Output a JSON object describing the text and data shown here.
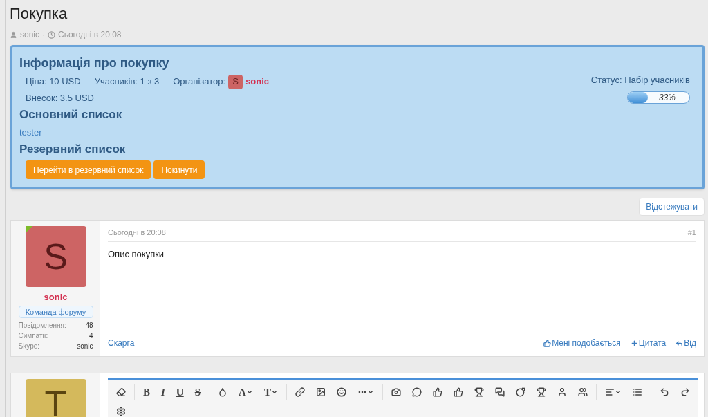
{
  "page": {
    "title": "Покупка",
    "author": "sonic",
    "separator": "·",
    "time": "Сьогодні в 20:08"
  },
  "purchase": {
    "heading": "Інформація про покупку",
    "price": "Ціна: 10 USD",
    "participants": "Учасників: 1 з 3",
    "organizer_label": "Організатор:",
    "organizer_avatar": "S",
    "organizer": "sonic",
    "fee": "Внесок: 3.5 USD",
    "status": "Статус: Набір учасників",
    "progress": {
      "level": 0.33,
      "reading": "33%"
    },
    "main_list_heading": "Основний список",
    "main_list": [
      "tester"
    ],
    "reserve_list_heading": "Резервний список",
    "buttons": [
      "Перейти в резервний список",
      "Покинути"
    ]
  },
  "follow_button": "Відстежувати",
  "posts": [
    {
      "avatar": "S",
      "color": "#cd6464",
      "online": true,
      "username": "sonic",
      "user_title": "Команда форуму",
      "stats": [
        {
          "label": "Повідомлення:",
          "value": "48"
        },
        {
          "label": "Симпатії:",
          "value": "4"
        },
        {
          "label": "Skype:",
          "value": "sonic"
        }
      ],
      "time": "Сьогодні в 20:08",
      "number": "#1",
      "body": "Опис покупки",
      "report": "Скарга",
      "actions": [
        "Мені подобається",
        "Цитата",
        "Від"
      ]
    }
  ],
  "reply": {
    "avatar": "T",
    "color": "#d4b95c",
    "toolbar": [
      {
        "kind": "icon"
      },
      {
        "kind": "sep"
      },
      {
        "kind": "bold",
        "label": "B"
      },
      {
        "kind": "italic",
        "label": "I"
      },
      {
        "kind": "underline",
        "label": "U"
      },
      {
        "kind": "strike",
        "label": "S"
      },
      {
        "kind": "sep"
      },
      {
        "kind": "icon"
      },
      {
        "kind": "glyph",
        "label": "A",
        "menu": true
      },
      {
        "kind": "glyph",
        "label": "T",
        "menu": true
      },
      {
        "kind": "sep"
      },
      {
        "kind": "icon"
      },
      {
        "kind": "icon"
      },
      {
        "kind": "icon"
      },
      {
        "kind": "icon",
        "menu": true
      },
      {
        "kind": "sep"
      },
      {
        "kind": "icon"
      },
      {
        "kind": "icon"
      },
      {
        "kind": "icon"
      },
      {
        "kind": "icon"
      },
      {
        "kind": "icon"
      },
      {
        "kind": "icon"
      },
      {
        "kind": "icon"
      },
      {
        "kind": "icon"
      },
      {
        "kind": "icon"
      },
      {
        "kind": "icon"
      },
      {
        "kind": "sep"
      },
      {
        "kind": "icon",
        "menu": true
      },
      {
        "kind": "icon"
      },
      {
        "kind": "sep"
      },
      {
        "kind": "icon"
      },
      {
        "kind": "icon"
      },
      {
        "kind": "break"
      },
      {
        "kind": "icon"
      }
    ]
  }
}
